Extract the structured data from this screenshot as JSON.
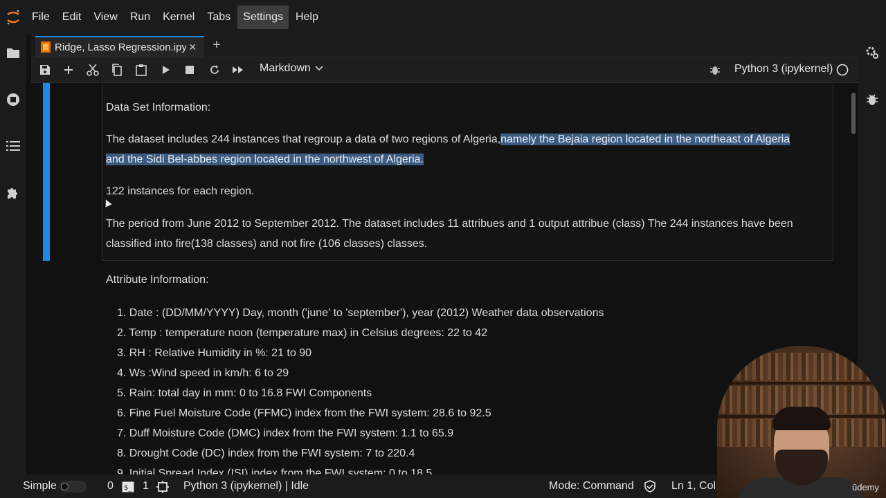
{
  "menubar": {
    "items": [
      "File",
      "Edit",
      "View",
      "Run",
      "Kernel",
      "Tabs",
      "Settings",
      "Help"
    ],
    "active": "Settings"
  },
  "tabs": [
    {
      "label": "Ridge, Lasso Regression.ipynb",
      "active": true
    }
  ],
  "toolbar": {
    "cell_type": "Markdown",
    "kernel_name": "Python 3 (ipykernel)"
  },
  "notebook": {
    "data_set_heading": "Data Set Information:",
    "para1_plain": "The dataset includes 244 instances that regroup a data of two regions of Algeria,",
    "para1_highlight_a": "namely the Bejaia region located in the northeast of Algeria",
    "para1_highlight_b": "and the Sidi Bel-abbes region located in the northwest of Algeria.",
    "para2": "122 instances for each region.",
    "para3_line1": "The period from June 2012 to September 2012. The dataset includes 11 attribues and 1 output attribue (class) The 244 instances have been",
    "para3_line2": "classified into fire(138 classes) and not fire (106 classes) classes.",
    "attribute_heading": "Attribute Information:",
    "attributes": [
      "1. Date : (DD/MM/YYYY) Day, month ('june' to 'september'), year (2012) Weather data observations",
      "2. Temp : temperature noon (temperature max) in Celsius degrees: 22 to 42",
      "3. RH : Relative Humidity in %: 21 to 90",
      "4. Ws :Wind speed in km/h: 6 to 29",
      "5. Rain: total day in mm: 0 to 16.8 FWI Components",
      "6. Fine Fuel Moisture Code (FFMC) index from the FWI system: 28.6 to 92.5",
      "7. Duff Moisture Code (DMC) index from the FWI system: 1.1 to 65.9",
      "8. Drought Code (DC) index from the FWI system: 7 to 220.4",
      "9. Initial Spread Index (ISI) index from the FWI system: 0 to 18.5"
    ]
  },
  "statusbar": {
    "mode_simple": "Simple",
    "terminals": "0",
    "kernels": "1",
    "kernel_status": "Python 3 (ipykernel) | Idle",
    "mode": "Mode: Command",
    "cursor_pos": "Ln 1, Col 1"
  },
  "watermark": "ūdemy",
  "colors": {
    "accent": "#1e88e5",
    "highlight": "#3d5a80",
    "background": "#111111"
  }
}
